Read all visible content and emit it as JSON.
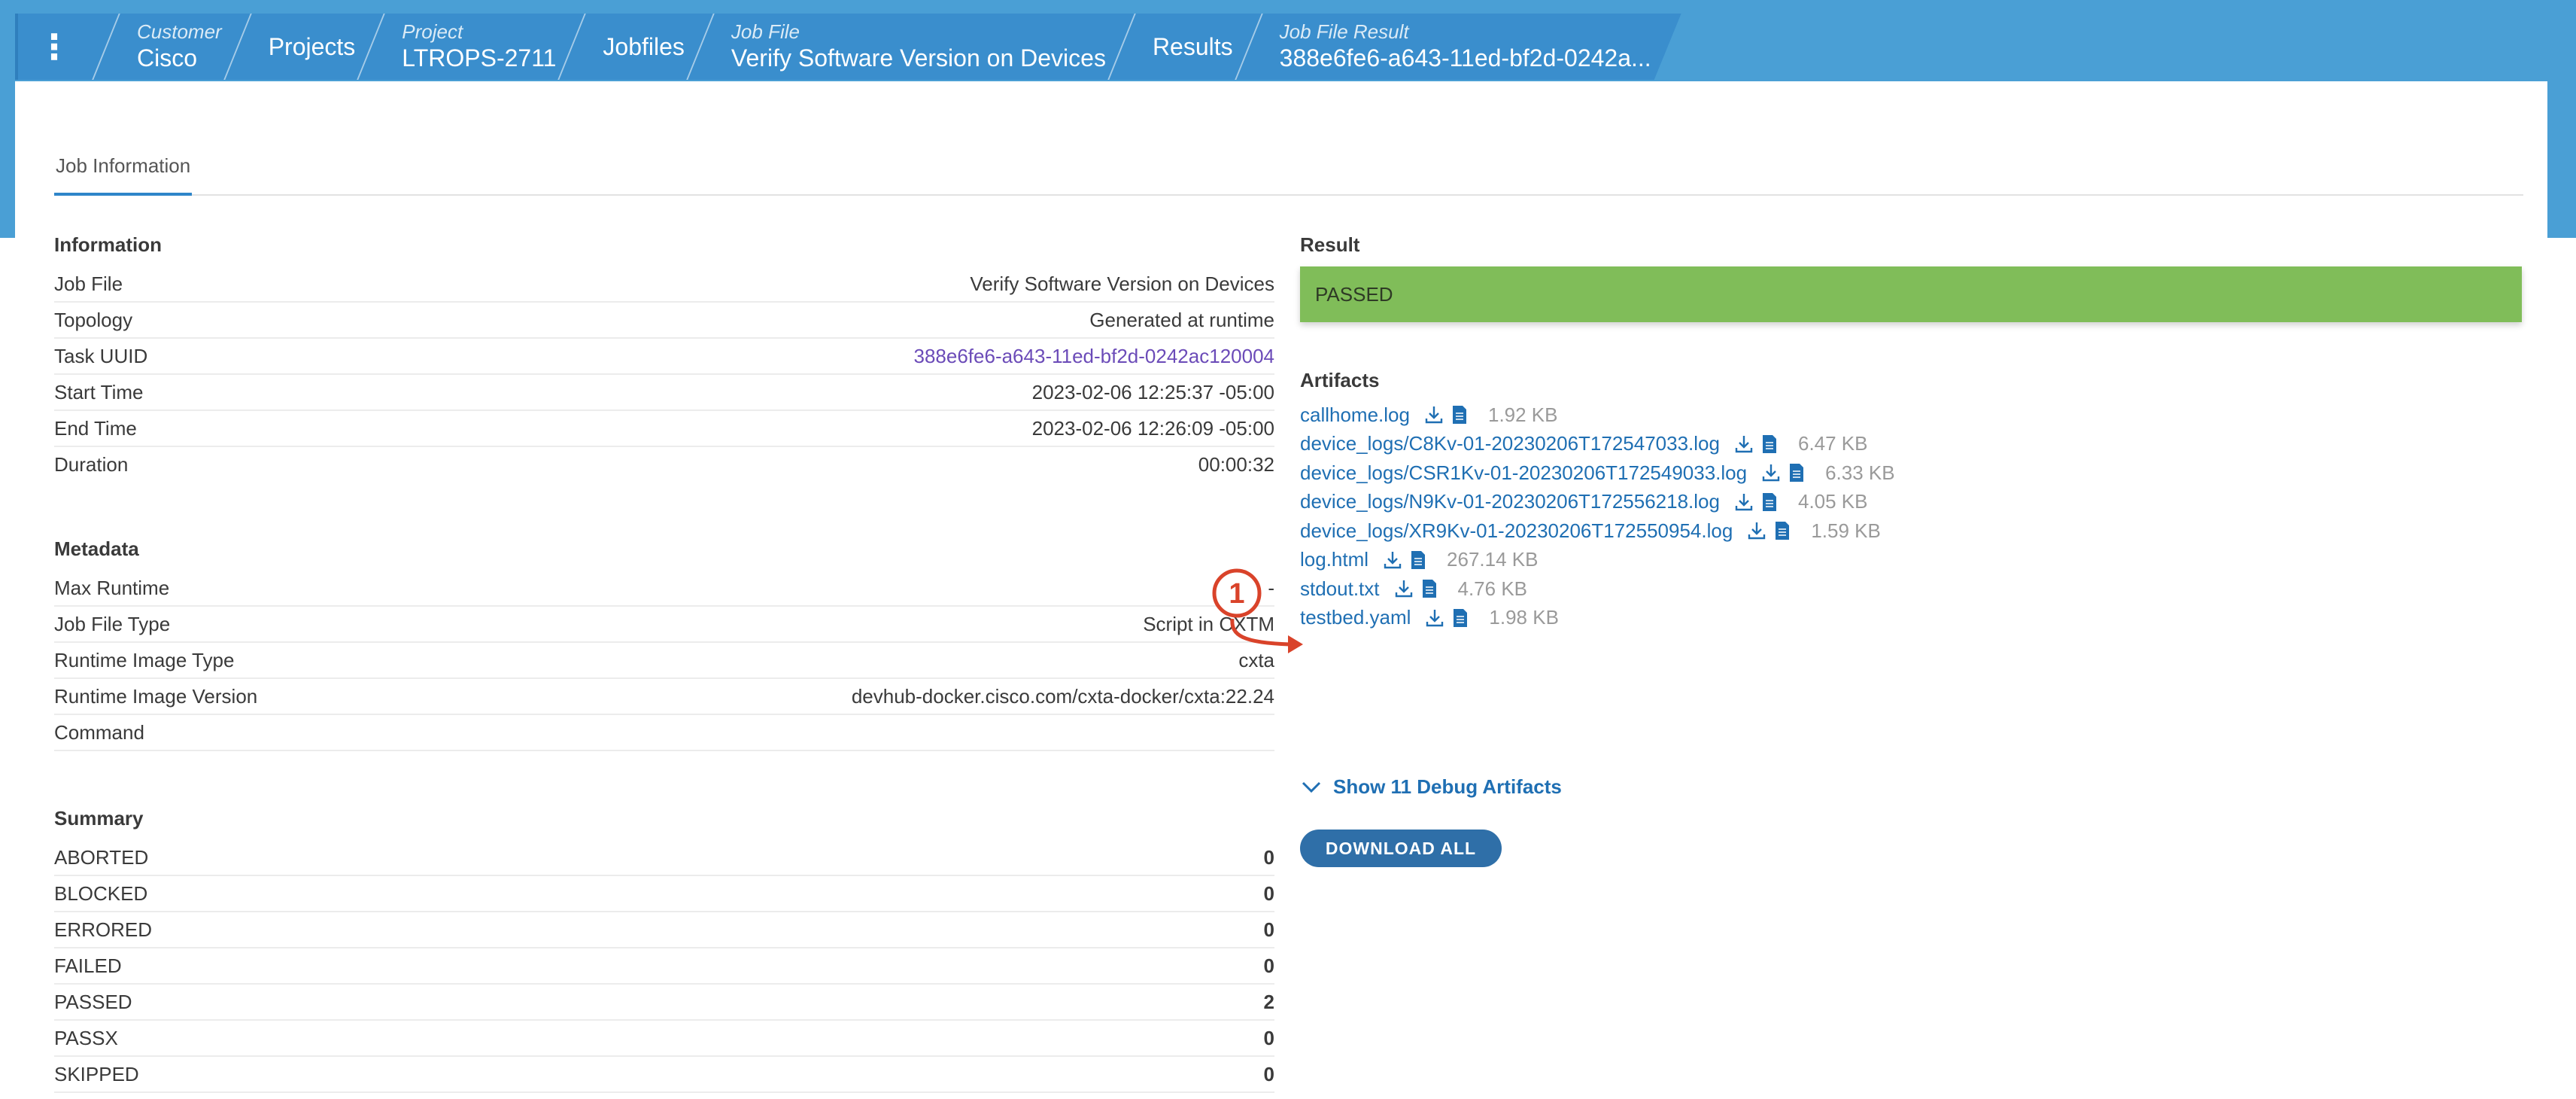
{
  "breadcrumbs": [
    {
      "label": "Customer",
      "value": "Cisco"
    },
    {
      "label": "",
      "value": "Projects"
    },
    {
      "label": "Project",
      "value": "LTROPS-2711"
    },
    {
      "label": "",
      "value": "Jobfiles"
    },
    {
      "label": "Job File",
      "value": "Verify Software Version on Devices"
    },
    {
      "label": "",
      "value": "Results"
    },
    {
      "label": "Job File Result",
      "value": "388e6fe6-a643-11ed-bf2d-0242a..."
    }
  ],
  "menu_glyph": "⋮",
  "tab": "Job Information",
  "information": {
    "title": "Information",
    "rows": [
      {
        "key": "Job File",
        "value": "Verify Software Version on Devices"
      },
      {
        "key": "Topology",
        "value": "Generated at runtime"
      },
      {
        "key": "Task UUID",
        "value": "388e6fe6-a643-11ed-bf2d-0242ac120004"
      },
      {
        "key": "Start Time",
        "value": "2023-02-06 12:25:37 -05:00"
      },
      {
        "key": "End Time",
        "value": "2023-02-06 12:26:09 -05:00"
      },
      {
        "key": "Duration",
        "value": "00:00:32"
      }
    ]
  },
  "metadata": {
    "title": "Metadata",
    "rows": [
      {
        "key": "Max Runtime",
        "value": "-"
      },
      {
        "key": "Job File Type",
        "value": "Script in CXTM"
      },
      {
        "key": "Runtime Image Type",
        "value": "cxta"
      },
      {
        "key": "Runtime Image Version",
        "value": "devhub-docker.cisco.com/cxta-docker/cxta:22.24"
      },
      {
        "key": "Command",
        "value": ""
      }
    ]
  },
  "summary": {
    "title": "Summary",
    "rows": [
      {
        "key": "ABORTED",
        "value": "0"
      },
      {
        "key": "BLOCKED",
        "value": "0"
      },
      {
        "key": "ERRORED",
        "value": "0"
      },
      {
        "key": "FAILED",
        "value": "0"
      },
      {
        "key": "PASSED",
        "value": "2"
      },
      {
        "key": "PASSX",
        "value": "0"
      },
      {
        "key": "SKIPPED",
        "value": "0"
      }
    ]
  },
  "result": {
    "title": "Result",
    "status": "PASSED",
    "color": "#80bd59"
  },
  "artifacts": {
    "title": "Artifacts",
    "items": [
      {
        "name": "callhome.log",
        "size": "1.92 KB"
      },
      {
        "name": "device_logs/C8Kv-01-20230206T172547033.log",
        "size": "6.47 KB"
      },
      {
        "name": "device_logs/CSR1Kv-01-20230206T172549033.log",
        "size": "6.33 KB"
      },
      {
        "name": "device_logs/N9Kv-01-20230206T172556218.log",
        "size": "4.05 KB"
      },
      {
        "name": "device_logs/XR9Kv-01-20230206T172550954.log",
        "size": "1.59 KB"
      },
      {
        "name": "log.html",
        "size": "267.14 KB"
      },
      {
        "name": "stdout.txt",
        "size": "4.76 KB"
      },
      {
        "name": "testbed.yaml",
        "size": "1.98 KB"
      }
    ]
  },
  "debug_toggle": "Show 11 Debug Artifacts",
  "download_all": "DOWNLOAD ALL",
  "annotation": {
    "number": "1",
    "color": "#d9432a"
  },
  "colors": {
    "header": "#4a9fd5",
    "link": "#1f6fb3",
    "uuid": "#6b4bb8",
    "button": "#2f6fa8"
  }
}
